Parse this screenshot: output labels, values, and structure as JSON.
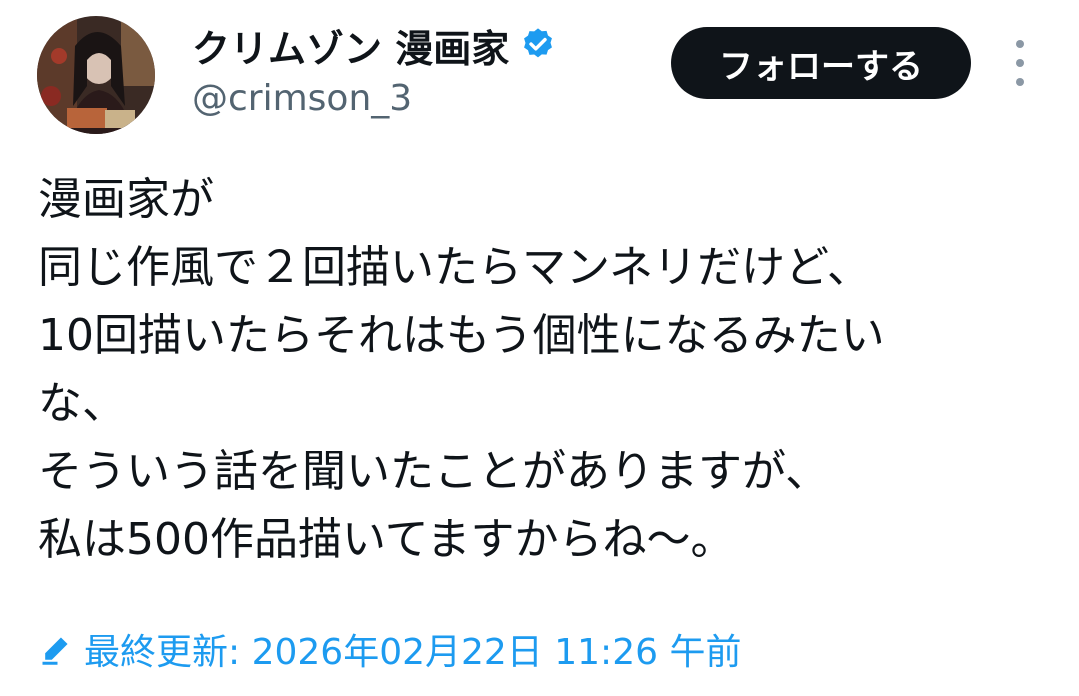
{
  "user": {
    "display_name": "クリムゾン 漫画家",
    "handle": "@crimson_3",
    "verified_icon": "verified-badge-icon",
    "avatar_icon": "profile-avatar"
  },
  "header": {
    "follow_label": "フォローする",
    "more_icon": "more-vertical-icon"
  },
  "tweet": {
    "lines": [
      "漫画家が",
      "同じ作風で２回描いたらマンネリだけど、",
      "10回描いたらそれはもう個性になるみたい",
      "な、",
      "そういう話を聞いたことがありますが、",
      "私は500作品描いてますからね〜。"
    ]
  },
  "edited": {
    "icon": "pencil-icon",
    "label": "最終更新: 2026年02月22日 11:26 午前"
  },
  "colors": {
    "accent": "#1d9bf0",
    "text": "#0f1419",
    "secondary": "#536471",
    "button_bg": "#0f1419"
  }
}
